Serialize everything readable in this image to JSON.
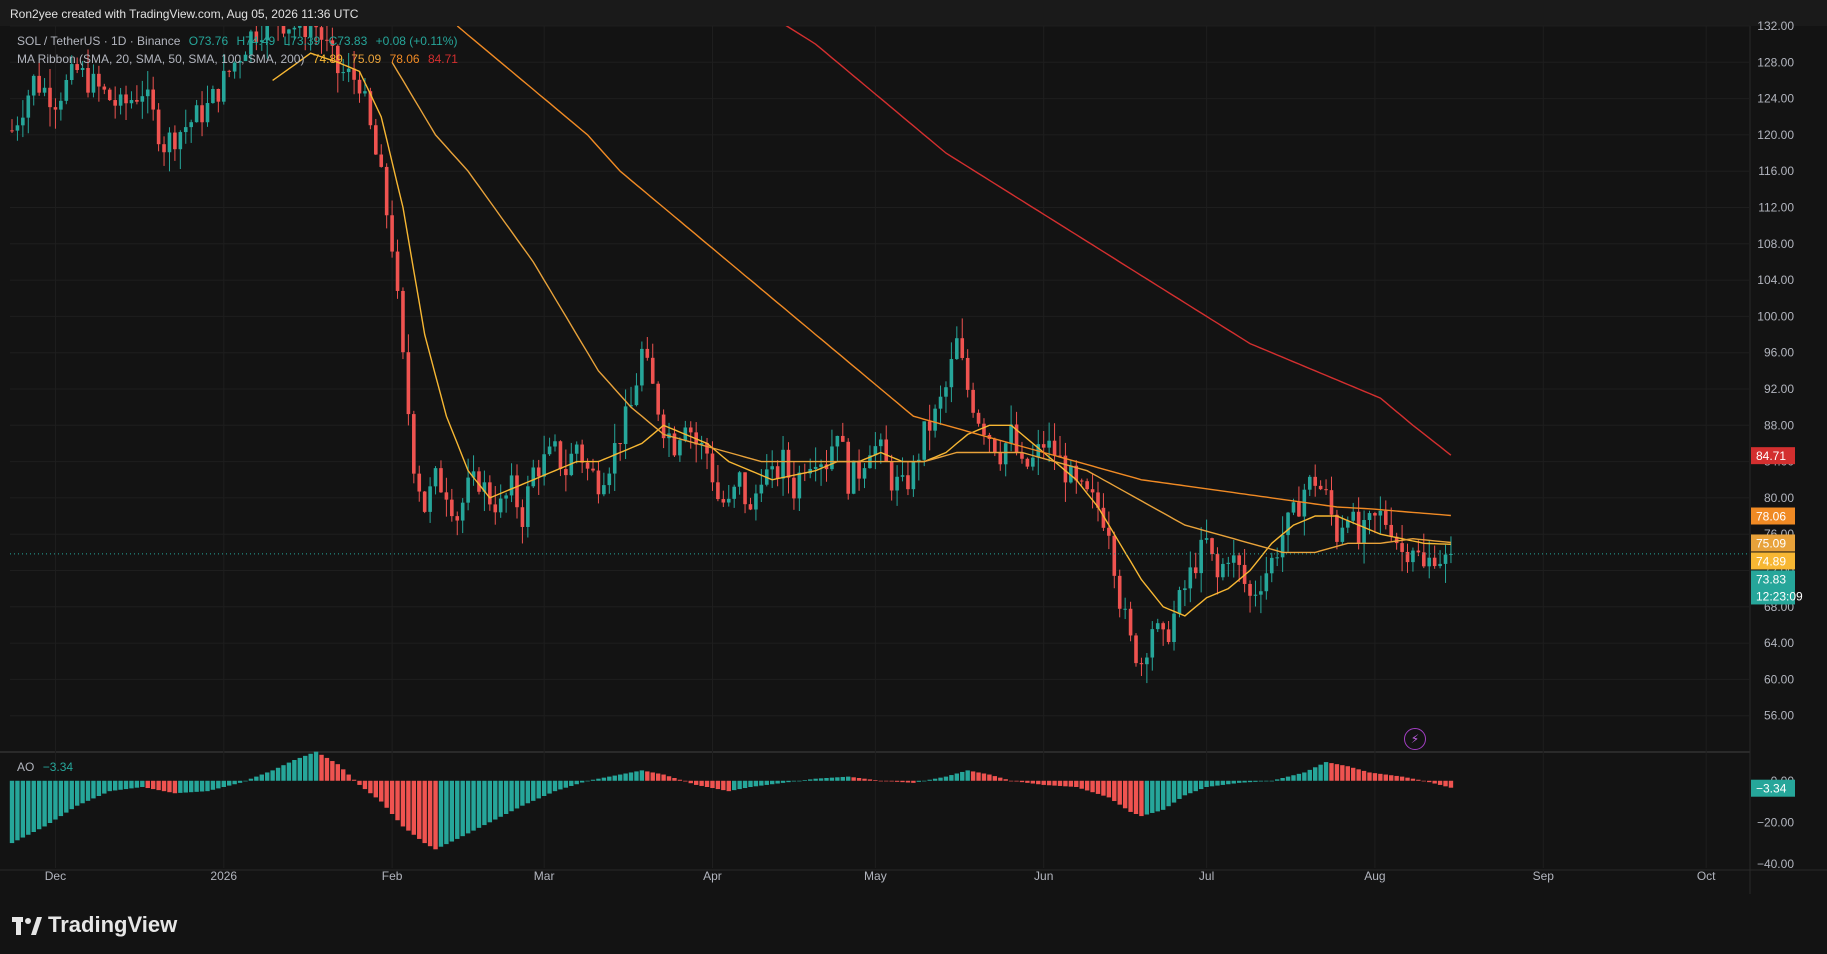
{
  "header": {
    "credit": "Ron2yee created with TradingView.com, Aug 05, 2026 11:36 UTC"
  },
  "legend": {
    "symbol": "SOL / TetherUS · 1D · Binance",
    "o": "O73.76",
    "h": "H74.49",
    "l": "L73.39",
    "c": "C73.83",
    "chg": "+0.08 (+0.11%)",
    "ribbon_label": "MA Ribbon (SMA, 20, SMA, 50, SMA, 100, SMA, 200)",
    "ribbon_values": [
      "74.89",
      "75.09",
      "78.06",
      "84.71"
    ],
    "ao_label": "AO",
    "ao_value": "−3.34"
  },
  "brand": {
    "name": "TradingView"
  },
  "colors": {
    "up": "#26a69a",
    "down": "#ef5350",
    "ma20": "#f7b733",
    "ma50": "#e8a23a",
    "ma100": "#f08a24",
    "ma200": "#d32f2f",
    "price_line": "#26a69a"
  },
  "chart_data": {
    "type": "candlestick",
    "ylim": [
      52,
      132
    ],
    "y_ticks": [
      "132.00",
      "128.00",
      "124.00",
      "120.00",
      "116.00",
      "112.00",
      "108.00",
      "104.00",
      "100.00",
      "96.00",
      "92.00",
      "88.00",
      "84.00",
      "80.00",
      "76.00",
      "72.00",
      "68.00",
      "64.00",
      "60.00",
      "56.00"
    ],
    "x_labels": [
      {
        "label": "Dec",
        "day": 8
      },
      {
        "label": "2026",
        "day": 39
      },
      {
        "label": "Feb",
        "day": 70
      },
      {
        "label": "Mar",
        "day": 98
      },
      {
        "label": "Apr",
        "day": 129
      },
      {
        "label": "May",
        "day": 159
      },
      {
        "label": "Jun",
        "day": 190
      },
      {
        "label": "Jul",
        "day": 220
      },
      {
        "label": "Aug",
        "day": 251
      },
      {
        "label": "Sep",
        "day": 282
      },
      {
        "label": "Oct",
        "day": 312
      }
    ],
    "price_key_points": [
      [
        0,
        120.5
      ],
      [
        4,
        126
      ],
      [
        8,
        124
      ],
      [
        12,
        127
      ],
      [
        16,
        125
      ],
      [
        20,
        123
      ],
      [
        24,
        125
      ],
      [
        28,
        119
      ],
      [
        32,
        121
      ],
      [
        36,
        123
      ],
      [
        40,
        127
      ],
      [
        44,
        131
      ],
      [
        48,
        133
      ],
      [
        52,
        132
      ],
      [
        56,
        132
      ],
      [
        60,
        127
      ],
      [
        64,
        126
      ],
      [
        68,
        115
      ],
      [
        70,
        108
      ],
      [
        72,
        95
      ],
      [
        74,
        84
      ],
      [
        76,
        79
      ],
      [
        78,
        82
      ],
      [
        80,
        81
      ],
      [
        82,
        78
      ],
      [
        84,
        81
      ],
      [
        86,
        82
      ],
      [
        88,
        80
      ],
      [
        90,
        79
      ],
      [
        92,
        81
      ],
      [
        94,
        78
      ],
      [
        96,
        83
      ],
      [
        98,
        84
      ],
      [
        100,
        85
      ],
      [
        102,
        83
      ],
      [
        104,
        86
      ],
      [
        106,
        83
      ],
      [
        108,
        82
      ],
      [
        110,
        84
      ],
      [
        112,
        87
      ],
      [
        114,
        90
      ],
      [
        116,
        96
      ],
      [
        118,
        92
      ],
      [
        120,
        88
      ],
      [
        122,
        86
      ],
      [
        124,
        89
      ],
      [
        126,
        86
      ],
      [
        128,
        85
      ],
      [
        130,
        80
      ],
      [
        132,
        79
      ],
      [
        134,
        82
      ],
      [
        136,
        78
      ],
      [
        138,
        83
      ],
      [
        140,
        82
      ],
      [
        142,
        84
      ],
      [
        144,
        81
      ],
      [
        146,
        84
      ],
      [
        148,
        85
      ],
      [
        150,
        84
      ],
      [
        152,
        88
      ],
      [
        154,
        82
      ],
      [
        156,
        83
      ],
      [
        158,
        86
      ],
      [
        160,
        85
      ],
      [
        162,
        82
      ],
      [
        164,
        81
      ],
      [
        166,
        83
      ],
      [
        168,
        87
      ],
      [
        170,
        89
      ],
      [
        172,
        92
      ],
      [
        174,
        97
      ],
      [
        176,
        92
      ],
      [
        178,
        89
      ],
      [
        180,
        87
      ],
      [
        182,
        85
      ],
      [
        184,
        87
      ],
      [
        186,
        83
      ],
      [
        188,
        84
      ],
      [
        190,
        86
      ],
      [
        192,
        85
      ],
      [
        194,
        83
      ],
      [
        196,
        81
      ],
      [
        198,
        80
      ],
      [
        200,
        79
      ],
      [
        202,
        77
      ],
      [
        204,
        69
      ],
      [
        206,
        64
      ],
      [
        208,
        62
      ],
      [
        210,
        66
      ],
      [
        212,
        64
      ],
      [
        214,
        67
      ],
      [
        216,
        70
      ],
      [
        218,
        73
      ],
      [
        220,
        75
      ],
      [
        222,
        71
      ],
      [
        224,
        74
      ],
      [
        226,
        72
      ],
      [
        228,
        69
      ],
      [
        230,
        71
      ],
      [
        232,
        73
      ],
      [
        234,
        76
      ],
      [
        236,
        78
      ],
      [
        238,
        81
      ],
      [
        240,
        82
      ],
      [
        242,
        80
      ],
      [
        244,
        76
      ],
      [
        246,
        79
      ],
      [
        248,
        75
      ],
      [
        250,
        77
      ],
      [
        252,
        78
      ],
      [
        254,
        77
      ],
      [
        256,
        74
      ],
      [
        258,
        75
      ],
      [
        260,
        72
      ],
      [
        262,
        74
      ],
      [
        264,
        73
      ],
      [
        265,
        73.83
      ]
    ],
    "ma_key_points": {
      "ma20": [
        [
          48,
          126
        ],
        [
          55,
          129
        ],
        [
          60,
          128
        ],
        [
          64,
          127
        ],
        [
          68,
          122
        ],
        [
          72,
          112
        ],
        [
          76,
          98
        ],
        [
          80,
          89
        ],
        [
          84,
          83
        ],
        [
          88,
          80
        ],
        [
          92,
          81
        ],
        [
          96,
          82
        ],
        [
          100,
          83
        ],
        [
          104,
          84
        ],
        [
          108,
          84
        ],
        [
          112,
          85
        ],
        [
          116,
          86
        ],
        [
          120,
          88
        ],
        [
          124,
          87
        ],
        [
          128,
          86
        ],
        [
          132,
          84
        ],
        [
          136,
          83
        ],
        [
          140,
          82
        ],
        [
          144,
          82.5
        ],
        [
          148,
          83
        ],
        [
          152,
          84
        ],
        [
          156,
          84
        ],
        [
          160,
          85
        ],
        [
          164,
          84
        ],
        [
          168,
          84
        ],
        [
          172,
          85
        ],
        [
          176,
          87
        ],
        [
          180,
          88
        ],
        [
          184,
          88
        ],
        [
          188,
          86
        ],
        [
          192,
          84
        ],
        [
          196,
          82
        ],
        [
          200,
          79
        ],
        [
          204,
          75
        ],
        [
          208,
          71
        ],
        [
          212,
          68
        ],
        [
          216,
          67
        ],
        [
          220,
          69
        ],
        [
          224,
          70
        ],
        [
          228,
          72
        ],
        [
          232,
          75
        ],
        [
          236,
          77
        ],
        [
          240,
          78
        ],
        [
          244,
          78
        ],
        [
          248,
          77
        ],
        [
          252,
          76
        ],
        [
          256,
          75.5
        ],
        [
          260,
          75
        ],
        [
          265,
          74.89
        ]
      ],
      "ma50": [
        [
          70,
          128
        ],
        [
          74,
          124
        ],
        [
          78,
          120
        ],
        [
          84,
          116
        ],
        [
          90,
          111
        ],
        [
          96,
          106
        ],
        [
          102,
          100
        ],
        [
          108,
          94
        ],
        [
          114,
          90
        ],
        [
          120,
          87
        ],
        [
          126,
          86
        ],
        [
          132,
          85
        ],
        [
          138,
          84
        ],
        [
          144,
          84
        ],
        [
          150,
          84
        ],
        [
          156,
          84
        ],
        [
          162,
          84
        ],
        [
          168,
          84
        ],
        [
          174,
          85
        ],
        [
          180,
          85
        ],
        [
          186,
          85
        ],
        [
          192,
          84
        ],
        [
          198,
          83
        ],
        [
          204,
          81
        ],
        [
          210,
          79
        ],
        [
          216,
          77
        ],
        [
          222,
          76
        ],
        [
          228,
          75
        ],
        [
          234,
          74
        ],
        [
          240,
          74
        ],
        [
          246,
          75
        ],
        [
          252,
          75
        ],
        [
          258,
          75.5
        ],
        [
          265,
          75.09
        ]
      ],
      "ma100": [
        [
          82,
          132
        ],
        [
          88,
          129
        ],
        [
          94,
          126
        ],
        [
          100,
          123
        ],
        [
          106,
          120
        ],
        [
          112,
          116
        ],
        [
          118,
          113
        ],
        [
          124,
          110
        ],
        [
          130,
          107
        ],
        [
          136,
          104
        ],
        [
          142,
          101
        ],
        [
          148,
          98
        ],
        [
          154,
          95
        ],
        [
          160,
          92
        ],
        [
          166,
          89
        ],
        [
          172,
          88
        ],
        [
          178,
          87
        ],
        [
          184,
          86
        ],
        [
          190,
          85
        ],
        [
          196,
          84
        ],
        [
          202,
          83
        ],
        [
          208,
          82
        ],
        [
          214,
          81.5
        ],
        [
          220,
          81
        ],
        [
          226,
          80.5
        ],
        [
          232,
          80
        ],
        [
          238,
          79.5
        ],
        [
          244,
          79
        ],
        [
          250,
          78.8
        ],
        [
          256,
          78.5
        ],
        [
          265,
          78.06
        ]
      ],
      "ma200": [
        [
          140,
          133
        ],
        [
          148,
          130
        ],
        [
          156,
          126
        ],
        [
          164,
          122
        ],
        [
          172,
          118
        ],
        [
          180,
          115
        ],
        [
          188,
          112
        ],
        [
          196,
          109
        ],
        [
          204,
          106
        ],
        [
          212,
          103
        ],
        [
          220,
          100
        ],
        [
          228,
          97
        ],
        [
          236,
          95
        ],
        [
          244,
          93
        ],
        [
          252,
          91
        ],
        [
          258,
          88
        ],
        [
          265,
          84.71
        ]
      ]
    },
    "ao_key_points": [
      [
        0,
        -30
      ],
      [
        6,
        -22
      ],
      [
        12,
        -12
      ],
      [
        18,
        -5
      ],
      [
        24,
        -3
      ],
      [
        30,
        -6
      ],
      [
        36,
        -5
      ],
      [
        42,
        -1
      ],
      [
        48,
        5
      ],
      [
        52,
        10
      ],
      [
        56,
        14
      ],
      [
        60,
        8
      ],
      [
        64,
        -2
      ],
      [
        68,
        -10
      ],
      [
        72,
        -22
      ],
      [
        76,
        -30
      ],
      [
        78,
        -33
      ],
      [
        82,
        -28
      ],
      [
        88,
        -20
      ],
      [
        94,
        -12
      ],
      [
        100,
        -5
      ],
      [
        106,
        0
      ],
      [
        112,
        3
      ],
      [
        116,
        5
      ],
      [
        120,
        3
      ],
      [
        126,
        -2
      ],
      [
        132,
        -5
      ],
      [
        136,
        -3
      ],
      [
        142,
        -1
      ],
      [
        148,
        1
      ],
      [
        154,
        2
      ],
      [
        160,
        0
      ],
      [
        166,
        -1
      ],
      [
        172,
        2
      ],
      [
        176,
        5
      ],
      [
        180,
        3
      ],
      [
        184,
        0
      ],
      [
        190,
        -2
      ],
      [
        196,
        -3
      ],
      [
        202,
        -8
      ],
      [
        206,
        -15
      ],
      [
        208,
        -17
      ],
      [
        212,
        -14
      ],
      [
        216,
        -7
      ],
      [
        220,
        -3
      ],
      [
        226,
        -1
      ],
      [
        232,
        0
      ],
      [
        238,
        4
      ],
      [
        242,
        9
      ],
      [
        246,
        7
      ],
      [
        250,
        4
      ],
      [
        256,
        2
      ],
      [
        260,
        0
      ],
      [
        265,
        -3.34
      ]
    ],
    "ao_ylim": [
      -42,
      10
    ],
    "ao_ticks": [
      "0.00",
      "−20.00",
      "−40.00"
    ],
    "last_day": 265,
    "last_price": 73.83,
    "price_labels": [
      {
        "text": "84.71",
        "value": 84.71,
        "color": "#d32f2f"
      },
      {
        "text": "78.06",
        "value": 78.06,
        "color": "#f08a24"
      },
      {
        "text": "75.09",
        "value": 75.09,
        "color": "#e8a23a"
      },
      {
        "text": "74.89",
        "value": 74.89,
        "color": "#f7b733"
      },
      {
        "text": "73.83",
        "value": 73.83,
        "color": "#26a69a"
      }
    ],
    "countdown": "12:23:09",
    "ao_label_value": "−3.34"
  }
}
